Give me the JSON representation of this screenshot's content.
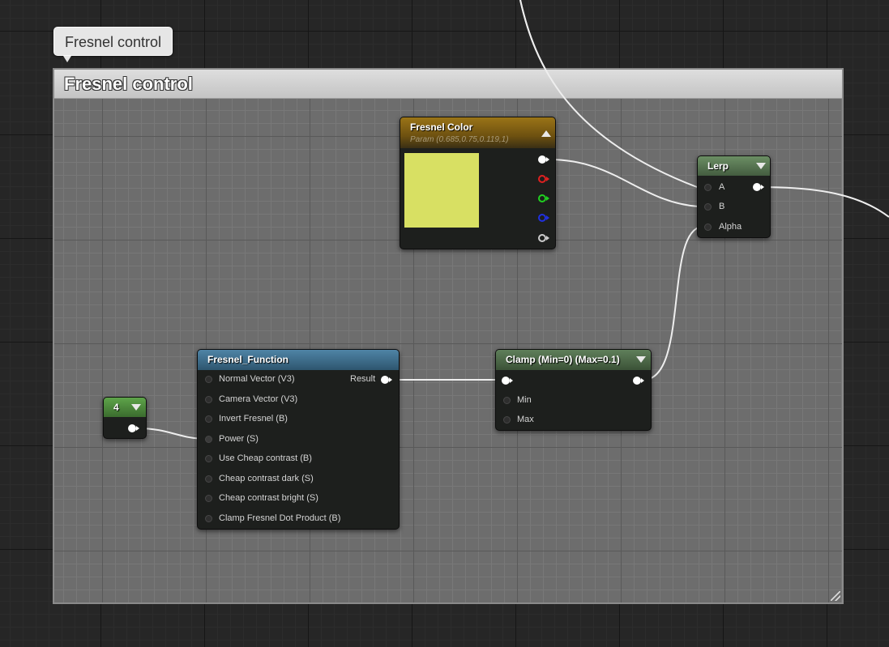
{
  "comment": {
    "bubble": "Fresnel control",
    "title": "Fresnel control"
  },
  "nodes": {
    "fresnel_color": {
      "title": "Fresnel Color",
      "subtitle": "Param (0.685,0.75,0.119,1)",
      "swatch": "#d8e063",
      "header_color": "#8f6a12",
      "outputs": [
        {
          "name": "rgba",
          "color": "#ffffff",
          "filled": true
        },
        {
          "name": "r",
          "color": "#e02020",
          "filled": false
        },
        {
          "name": "g",
          "color": "#20d020",
          "filled": false
        },
        {
          "name": "b",
          "color": "#2030e0",
          "filled": false
        },
        {
          "name": "a",
          "color": "#cccccc",
          "filled": false
        }
      ]
    },
    "lerp": {
      "title": "Lerp",
      "header_color": "#5b7a55",
      "inputs": [
        "A",
        "B",
        "Alpha"
      ]
    },
    "fresnel_function": {
      "title": "Fresnel_Function",
      "header_color": "#3d6f8e",
      "output": "Result",
      "inputs": [
        "Normal Vector (V3)",
        "Camera Vector (V3)",
        "Invert Fresnel (B)",
        "Power (S)",
        "Use Cheap contrast (B)",
        "Cheap contrast dark (S)",
        "Cheap contrast bright (S)",
        "Clamp Fresnel Dot Product (B)"
      ]
    },
    "clamp": {
      "title": "Clamp (Min=0) (Max=0.1)",
      "header_color": "#4e6b4a",
      "inputs": [
        "Min",
        "Max"
      ]
    },
    "constant": {
      "title": "4",
      "header_color": "#4c8a3a"
    }
  }
}
